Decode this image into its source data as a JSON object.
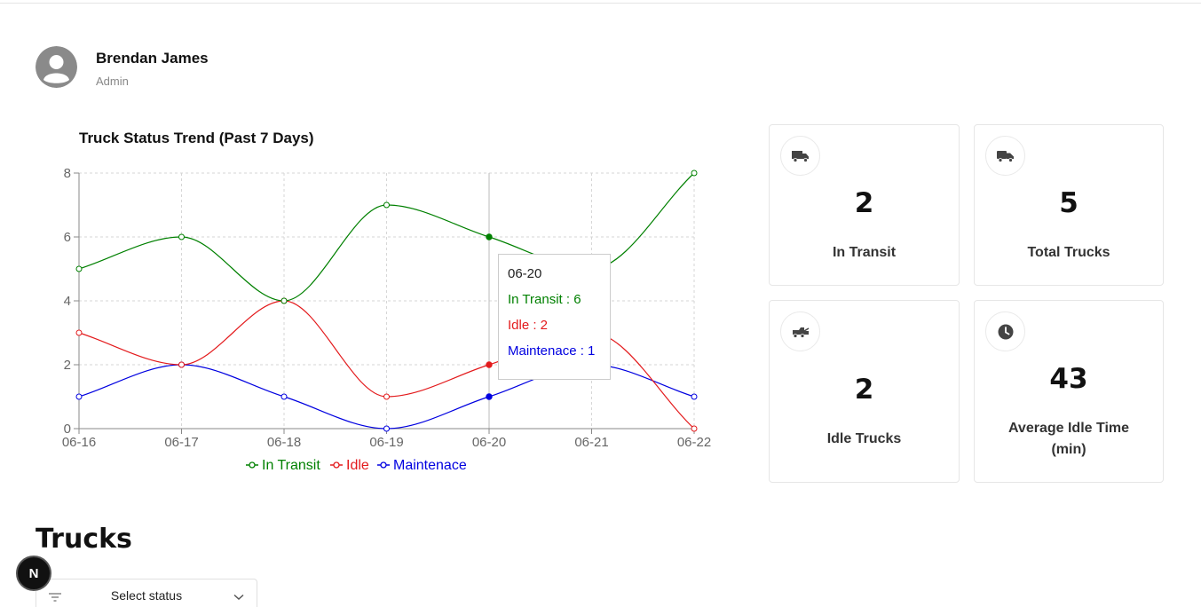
{
  "profile": {
    "name": "Brendan James",
    "role": "Admin",
    "avatar_icon": "user-avatar-icon"
  },
  "chart_data": {
    "type": "line",
    "title": "Truck Status Trend (Past 7 Days)",
    "categories": [
      "06-16",
      "06-17",
      "06-18",
      "06-19",
      "06-20",
      "06-21",
      "06-22"
    ],
    "series": [
      {
        "name": "In Transit",
        "color": "#008000",
        "values": [
          5,
          6,
          4,
          7,
          6,
          5,
          8
        ]
      },
      {
        "name": "Idle",
        "color": "#e31a1c",
        "values": [
          3,
          2,
          4,
          1,
          2,
          3,
          0
        ]
      },
      {
        "name": "Maintenace",
        "color": "#0000e0",
        "values": [
          1,
          2,
          1,
          0,
          1,
          2,
          1
        ]
      }
    ],
    "yticks": [
      0,
      2,
      4,
      6,
      8
    ],
    "ylim": [
      0,
      8
    ],
    "grid": true,
    "legend": "bottom",
    "tooltip": {
      "label": "06-20",
      "rows": [
        "In Transit : 6",
        "Idle : 2",
        "Maintenace : 1"
      ]
    },
    "active_index": 4
  },
  "stats": [
    {
      "value": "2",
      "label": "In Transit",
      "icon": "truck-icon"
    },
    {
      "value": "5",
      "label": "Total Trucks",
      "icon": "truck-icon"
    },
    {
      "value": "2",
      "label": "Idle Trucks",
      "icon": "tow-truck-icon"
    },
    {
      "value": "43",
      "label": "Average Idle Time (min)",
      "icon": "clock-icon"
    }
  ],
  "trucks": {
    "title": "Trucks",
    "status_placeholder": "Select status"
  },
  "badge": {
    "letter": "N"
  }
}
